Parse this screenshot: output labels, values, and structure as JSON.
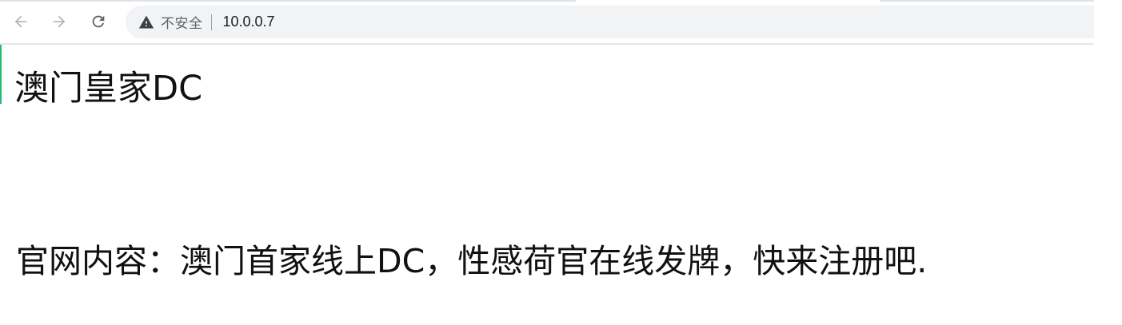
{
  "browser": {
    "security_label": "不安全",
    "url": "10.0.0.7",
    "colors": {
      "omnibox_bg": "#f1f3f4",
      "icon": "#5f6368",
      "accent_edge": "#1fbf73"
    },
    "icons": {
      "back": "arrow-left-icon",
      "forward": "arrow-right-icon",
      "reload": "reload-icon",
      "warning": "warning-triangle-icon"
    }
  },
  "page": {
    "heading": "澳门皇家DC",
    "body_text": "官网内容：澳门首家线上DC，性感荷官在线发牌，快来注册吧."
  }
}
